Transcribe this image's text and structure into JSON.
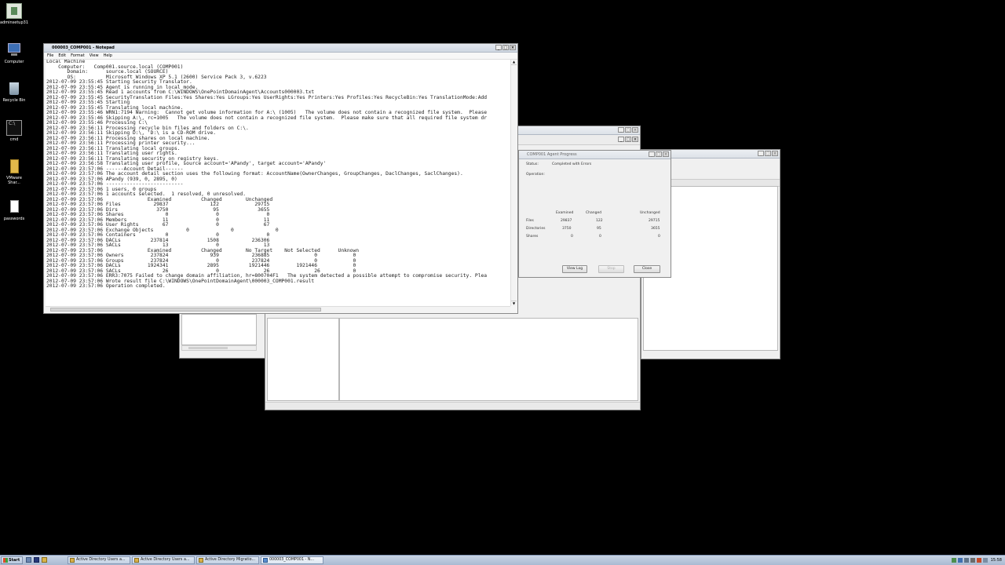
{
  "desktop_icons": [
    {
      "label": "adminsetup31",
      "icon": "installer-icon"
    },
    {
      "label": "Computer",
      "icon": "computer-icon"
    },
    {
      "label": "Recycle Bin",
      "icon": "recycle-bin-icon"
    },
    {
      "label": "cmd",
      "icon": "console-icon"
    },
    {
      "label": "VMware Shar...",
      "icon": "folder-icon"
    },
    {
      "label": "passwords",
      "icon": "document-icon"
    }
  ],
  "notepad": {
    "title": "000003_COMP001 - Notepad",
    "menu": [
      "File",
      "Edit",
      "Format",
      "View",
      "Help"
    ],
    "lines": [
      "Local Machine",
      "    Computer:   Comp001.source.local (COMP001)",
      "       Domain:      source.local (SOURCE)",
      "       OS:          Microsoft Windows XP 5.1 (2600) Service Pack 3, v.6223",
      "2012-07-09 23:55:45 Starting Security Translator.",
      "2012-07-09 23:55:45 Agent is running in local mode.",
      "2012-07-09 23:55:45 Read 1 accounts from C:\\WINDOWS\\OnePointDomainAgent\\Accounts000003.txt",
      "2012-07-09 23:55:45 SecurityTranslation Files:Yes Shares:Yes LGroups:Yes UserRights:Yes Printers:Yes Profiles:Yes RecycleBin:Yes TranslationMode:Add",
      "2012-07-09 23:55:45 Starting",
      "2012-07-09 23:55:45 Translating local machine.",
      "2012-07-09 23:55:46 WRN1:7194 Warning:  Cannot get volume information for A:\\ (1005)   The volume does not contain a recognized file system.  Please",
      "2012-07-09 23:55:46 Skipping A:\\, rc=1005   The volume does not contain a recognized file system.  Please make sure that all required file system dr",
      "2012-07-09 23:55:46 Processing C:\\",
      "2012-07-09 23:56:11 Processing recycle bin files and folders on C:\\.",
      "2012-07-09 23:56:11 Skipping D:\\, 'D:\\ is a CD-ROM drive.",
      "2012-07-09 23:56:11 Processing shares on local machine.",
      "2012-07-09 23:56:11 Processing printer security...",
      "2012-07-09 23:56:11 Translating local groups.",
      "2012-07-09 23:56:11 Translating user rights.",
      "2012-07-09 23:56:11 Translating security on registry keys.",
      "2012-07-09 23:56:58 Translating user profile, source account='APandy', target account='APandy'",
      "2012-07-09 23:57:06 ------Account Detail------",
      "2012-07-09 23:57:06 The account detail section uses the following format: AccountName(OwnerChanges, GroupChanges, DaclChanges, SaclChanges).",
      "2012-07-09 23:57:06 APandy (939, 0, 2895, 0)",
      "2012-07-09 23:57:06 --------------------------",
      "2012-07-09 23:57:06 1 users, 0 groups",
      "2012-07-09 23:57:06 1 accounts selected.  1 resolved, 0 unresolved.",
      "2012-07-09 23:57:06               Examined          Changed        Unchanged",
      "2012-07-09 23:57:06 Files           29837              122            29715",
      "2012-07-09 23:57:06 Dirs             3750               95             3655",
      "2012-07-09 23:57:06 Shares              0                0                0",
      "2012-07-09 23:57:06 Members            11                0               11",
      "2012-07-09 23:57:06 User Rights        67                0               67",
      "2012-07-09 23:57:06 Exchange Objects           0              0              0",
      "2012-07-09 23:57:06 Containers          0                0                0",
      "2012-07-09 23:57:06 DACLs          237814             1508           236306",
      "2012-07-09 23:57:06 SACLs              13                0               13",
      "2012-07-09 23:57:06               Examined          Changed        No Target    Not Selected      Unknown",
      "2012-07-09 23:57:06 Owners         237824              939           236885               0            0",
      "2012-07-09 23:57:06 Groups         237824                0           237824               0            0",
      "2012-07-09 23:57:06 DACLs         1924341             2895          1921446         1921446            0",
      "2012-07-09 23:57:06 SACLs              26                0               26               26           0",
      "2012-07-09 23:57:06 ERR3:7075 Failed to change domain affiliation, hr=800704F1   The system detected a possible attempt to compromise security. Plea",
      "2012-07-09 23:57:06 Wrote result file C:\\WINDOWS\\OnePointDomainAgent\\000003_COMP001.result",
      "2012-07-09 23:57:06 Operation completed."
    ]
  },
  "agent_progress": {
    "title": "COMP001 Agent Progress",
    "status_label": "Status:",
    "status_value": "Completed with Errors",
    "operation_label": "Operation:",
    "col_examined": "Examined",
    "col_changed": "Changed",
    "col_unchanged": "Unchanged",
    "rows": [
      {
        "label": "Files",
        "examined": "29837",
        "changed": "122",
        "unchanged": "29715"
      },
      {
        "label": "Directories",
        "examined": "3750",
        "changed": "95",
        "unchanged": "3655"
      },
      {
        "label": "Shares",
        "examined": "0",
        "changed": "0",
        "unchanged": "0"
      }
    ],
    "buttons": {
      "view_log": "View Log",
      "stop": "Stop",
      "close": "Close"
    }
  },
  "taskbar": {
    "start": "Start",
    "tasks": [
      "Active Directory Users a...",
      "Active Directory Users a...",
      "Active Directory Migratio...",
      "000003_COMP001 - N..."
    ],
    "clock": "15:58"
  }
}
